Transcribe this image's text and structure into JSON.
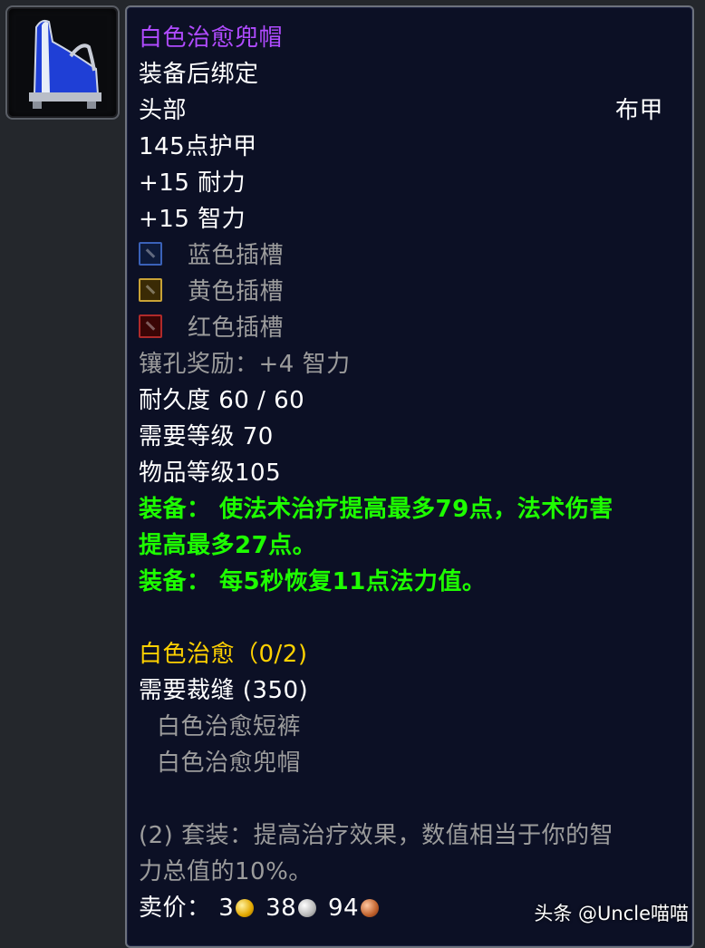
{
  "item": {
    "name": "白色治愈兜帽",
    "bind": "装备后绑定",
    "slot": "头部",
    "armor_type": "布甲",
    "armor": "145点护甲",
    "stat_stamina": "+15 耐力",
    "stat_intellect": "+15 智力",
    "sockets": [
      {
        "color": "blue",
        "label": "蓝色插槽"
      },
      {
        "color": "yellow",
        "label": "黄色插槽"
      },
      {
        "color": "red",
        "label": "红色插槽"
      }
    ],
    "socket_bonus": "镶孔奖励：+4 智力",
    "durability": "耐久度 60 / 60",
    "required_level": "需要等级 70",
    "item_level": "物品等级105",
    "equip_effects": [
      "装备：  使法术治疗提高最多79点，法术伤害",
      "提高最多27点。",
      "装备：  每5秒恢复11点法力值。"
    ],
    "set": {
      "name": "白色治愈（0/2)",
      "requirement": "需要裁缝 (350)",
      "pieces": [
        "白色治愈短裤",
        "白色治愈兜帽"
      ],
      "bonus_lines": [
        "(2) 套装：提高治疗效果，数值相当于你的智",
        "力总值的10%。"
      ]
    },
    "sell_price": {
      "label": "卖价：",
      "gold": "3",
      "silver": "38",
      "copper": "94"
    }
  },
  "watermark": "头条 @Uncle喵喵",
  "colors": {
    "epic_name": "#b04bff",
    "equip_green": "#1eff00",
    "set_gold": "#ffd100",
    "grey_text": "#9c9c9c",
    "tooltip_bg": "#0c1025"
  },
  "icons": {
    "item_icon": "blue-hood-icon",
    "socket_blue": "blue-socket-icon",
    "socket_yellow": "yellow-socket-icon",
    "socket_red": "red-socket-icon",
    "coin_gold": "gold-coin-icon",
    "coin_silver": "silver-coin-icon",
    "coin_copper": "copper-coin-icon"
  }
}
